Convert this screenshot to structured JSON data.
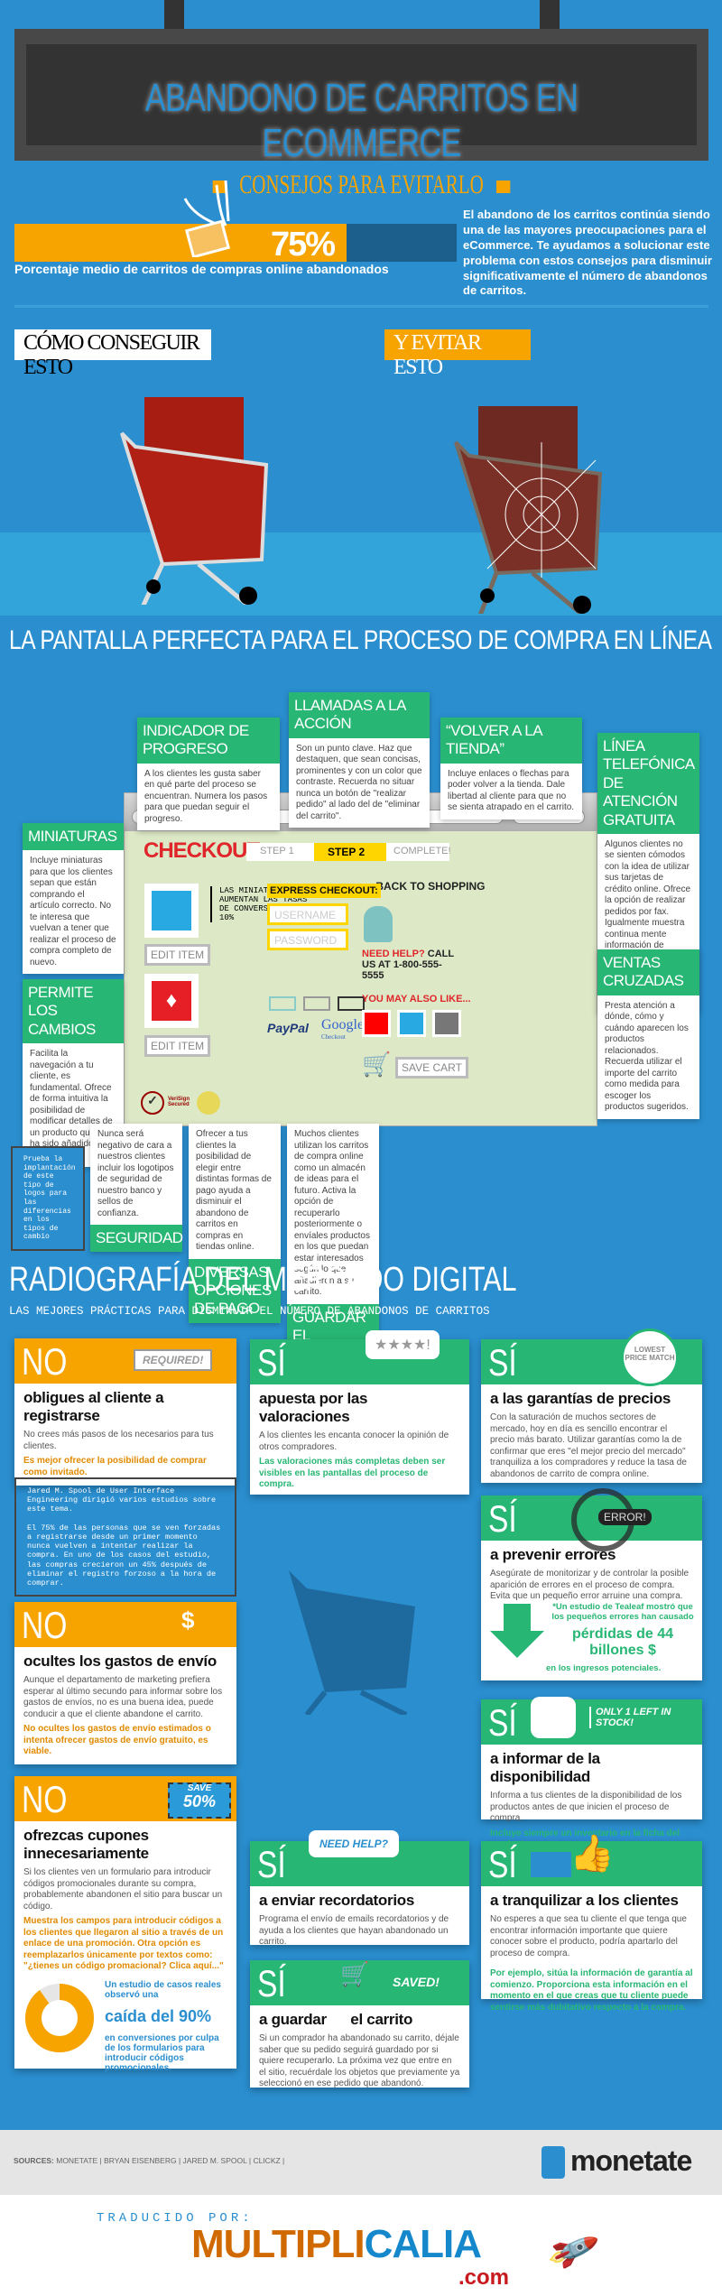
{
  "header": {
    "title": "ABANDONO DE CARRITOS EN ECOMMERCE",
    "subtitle": "CONSEJOS PARA EVITARLO"
  },
  "stat": {
    "value": "75%",
    "fraction": 0.75,
    "caption": "Porcentaje medio de carritos de compras online abandonados",
    "intro": "El abandono de los carritos continúa siendo una de las mayores preocupaciones para el eCommerce. Te ayudamos a solucionar este problema con estos consejos para disminuir significativamente el número de abandonos de carritos."
  },
  "compare": {
    "good": "CÓMO CONSEGUIR ESTO",
    "bad": "Y EVITAR ESTO"
  },
  "section1": "LA PANTALLA PERFECTA PARA EL PROCESO DE COMPRA EN LÍNEA",
  "callouts": {
    "progreso": {
      "title": "INDICADOR DE PROGRESO",
      "text": "A los clientes les gusta saber en qué parte del proceso se encuentran. Numera los pasos para que puedan seguir el progreso."
    },
    "accion": {
      "title": "LLAMADAS A LA ACCIÓN",
      "text": "Son un punto clave. Haz que destaquen, que sean concisas, prominentes y con un color que contraste. Recuerda no situar nunca un botón de \"realizar pedido\" al lado del de \"eliminar del carrito\"."
    },
    "volver": {
      "title": "“VOLVER A LA TIENDA”",
      "text": "Incluye enlaces o flechas para poder volver a la tienda. Dale libertad al cliente para que no se sienta atrapado en el carrito."
    },
    "telefono": {
      "title": "LÍNEA TELEFÓNICA DE ATENCIÓN GRATUITA",
      "text": "Algunos clientes no se sienten cómodos con la idea de utilizar sus tarjetas de crédito online. Ofrece la opción de realizar pedidos por fax. Igualmente muestra continua mente información de contacto durante el proceso de compra para aliviar las dudas respecto a la compra online."
    },
    "miniaturas": {
      "title": "MINIATURAS",
      "text": "Incluye miniaturas para que los clientes sepan que están comprando el artículo correcto. No te interesa que vuelvan a tener que realizar el proceso de compra completo de nuevo."
    },
    "cambios": {
      "title": "PERMITE LOS CAMBIOS",
      "text": "Facilita la navegación a tu cliente, es fundamental. Ofrece de forma intuitiva la posibilidad de modificar detalles de un producto que ya ha sido añadido al carrito."
    },
    "ventas": {
      "title": "VENTAS CRUZADAS",
      "text": "Presta atención a dónde, cómo y cuándo aparecen los productos relacionados. Recuerda utilizar el importe del carrito como medida para escoger los productos sugeridos."
    },
    "seguridad": {
      "title": "SEGURIDAD",
      "text": "Nunca será negativo de cara a nuestros clientes incluir los logotipos de seguridad de nuestro banco y sellos de confianza."
    },
    "pago": {
      "title": "DIVERSAS OPCIONES DE PAGO",
      "text": "Ofrecer a tus clientes la posibilidad de elegir entre distintas formas de pago ayuda a disminuir el abandono de carritos en compras en tiendas online."
    },
    "guardar": {
      "title": "GUARDAR EL CARRITO",
      "text": "Muchos clientes utilizan los carritos de compra online como un almacén de ideas para el futuro. Activa la opción de recuperarlo posteriormente o envíales productos en los que puedan estar interesados según lo que añadieron a su carrito."
    },
    "prueba": "Prueba la implantación de este tipo de logos para las diferencias en los tipos de cambio"
  },
  "checkout": {
    "title": "CHECKOUT",
    "steps": [
      "STEP 1",
      "STEP 2",
      "COMPLETE!"
    ],
    "back": "BACK TO SHOPPING",
    "thumb_note": "LAS MINIATURAS AUMENTAN LAS TASAS DE CONVERSION UN 10%",
    "edit": "EDIT ITEM",
    "express": "EXPRESS CHECKOUT:",
    "username": "USERNAME",
    "password": "PASSWORD",
    "paypal": "PayPal",
    "google": "Google",
    "google_sub": "Checkout",
    "help_red": "NEED HELP?",
    "help": " CALL US AT 1-800-555-5555",
    "also": "YOU MAY ALSO LIKE...",
    "save": "SAVE CART",
    "verisign": "VeriSign Secured"
  },
  "section2": {
    "title": "RADIOGRAFÍA DEL MERCADO DIGITAL",
    "subtitle": "LAS MEJORES PRÁCTICAS PARA DISMINUIR EL NÚMERO DE ABANDONOS DE CARRITOS"
  },
  "cards": {
    "registro": {
      "tag": "NO",
      "badge": "REQUIRED!",
      "title": "obligues al cliente a registrarse",
      "text": "No crees más pasos de los necesarios para tus clientes.",
      "tip": "Es mejor ofrecer la posibilidad de comprar como invitado."
    },
    "spool": {
      "p1": "Jared M. Spool de User Interface Engineering dirigió varios estudios sobre este tema.",
      "p2": "El 75% de las personas que se ven forzadas a registrarse desde un primer momento nunca vuelven a intentar realizar la compra. En uno de los casos del estudio, las compras crecieron un 45% después de eliminar el registro forzoso a la hora de comprar."
    },
    "envio": {
      "tag": "NO",
      "badge": "$",
      "title": "ocultes los gastos de envío",
      "text": "Aunque el departamento de marketing prefiera esperar al último  secundo para informar sobre los gastos de envíos, no es una buena idea, puede conducir a que el cliente abandone el carrito.",
      "tip": "No ocultes los gastos de envío estimados o intenta ofrecer gastos de envío gratuito, es viable."
    },
    "cupones": {
      "tag": "NO",
      "badge1": "SAVE",
      "badge2": "50%",
      "title": "ofrezcas cupones innecesariamente",
      "text": "Si los clientes ven un formulario para introducir códigos promocionales durante su compra, probablemente abandonen el sitio para buscar un código.",
      "tip": "Muestra los campos para introducir códigos a los clientes que llegaron al sitio a través de un enlace de una promoción. Otra opción es reemplazarlos únicamente por textos como: \"¿tienes un código promacional? Clica aquí...\"",
      "stat1": "Un estudio de casos reales observó una",
      "stat2": "caída del 90%",
      "stat3": "en conversiones por culpa de los formularios para introducir códigos promocionales.",
      "donut_fraction": 0.9
    },
    "valoraciones": {
      "tag": "SÍ",
      "badge": "★★★★!",
      "title": "apuesta por las valoraciones",
      "text": "A los clientes les encanta conocer la opinión de otros compradores.",
      "tip": "Las valoraciones más completas deben ser visibles en las pantallas del proceso de compra."
    },
    "recordatorios": {
      "tag": "SÍ",
      "badge": "NEED HELP?",
      "title": "a enviar recordatorios",
      "text": "Programa el envío de emails recordatorios y de ayuda a los clientes que hayan abandonado un carrito."
    },
    "guardar": {
      "tag": "SÍ",
      "badge": "SAVED!",
      "title": "a guardar      el carrito",
      "text": "Si un comprador ha abandonado su carrito, déjale saber que su pedido seguirá guardado por si quiere recuperarlo. La próxima vez que entre en el sitio, recuérdale los objetos que previamente ya seleccionó en ese pedido que abandonó."
    },
    "precios": {
      "tag": "SÍ",
      "badge": "LOWEST PRICE MATCH",
      "title": "a las garantías de precios",
      "text": "Con la saturación de muchos sectores de mercado, hoy en día es sencillo encontrar el precio más barato. Utilizar garantías como la de confirmar que eres \"el mejor precio del mercado\" tranquiliza a los compradores y reduce la tasa de abandonos de carrito de compra online."
    },
    "errores": {
      "tag": "SÍ",
      "badge": "ERROR!",
      "title": "a prevenir errores",
      "text": "Asegúrate de monitorizar y de controlar la posible aparición de errores en el proceso de compra. Evita que un pequeño error arruine una compra.",
      "tip1": "*Un estudio de Tealeaf mostró que los pequeños errores  han causado",
      "tip2": "pérdidas de 44 billones $",
      "tip3": "en los ingresos potenciales."
    },
    "disponibilidad": {
      "tag": "SÍ",
      "badge": "ONLY 1 LEFT IN STOCK!",
      "title": "a informar de la disponibilidad",
      "text": "Informa a tus clientes de la disponibilidad de los productos antes de que inicien el proceso de compra.",
      "tip": "Incluye siempre un inventario en la ficha del producto."
    },
    "tranquilizar": {
      "tag": "SÍ",
      "title": "a tranquilizar a los clientes",
      "text": "No esperes a que sea tu cliente el que tenga que encontrar información importante que quiere conocer sobre el producto, podría apartarlo del proceso de compra.",
      "tip": "Por ejemplo, sitúa la información de garantía al comienzo. Proporciona esta información en el momento en el que creas que tu cliente puede sentirse más dubitativo respecto a la compra."
    }
  },
  "footer": {
    "sources_label": "SOURCES:",
    "sources": " MONETATE | BRYAN EISENBERG | JARED M. SPOOL | CLICKZ |",
    "monetate": "monetate",
    "translated": "TRADUCIDO POR:",
    "brand1": "MULTIPLI",
    "brand2": "CALIA",
    "brand3": ".com"
  },
  "colors": {
    "blue": "#2a8ecf",
    "orange": "#f7a400",
    "green": "#27b673",
    "dark": "#333333",
    "red": "#e0262b"
  }
}
